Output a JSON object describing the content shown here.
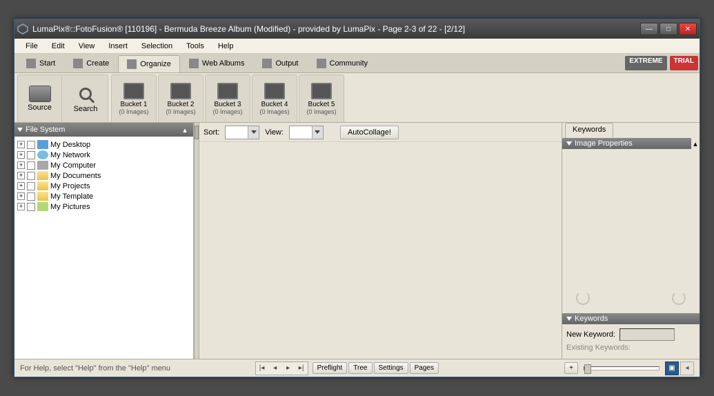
{
  "title": "LumaPix®::FotoFusion® [110196] - Bermuda Breeze Album (Modified) - provided by LumaPix - Page 2-3 of 22 - [2/12]",
  "menubar": [
    "File",
    "Edit",
    "View",
    "Insert",
    "Selection",
    "Tools",
    "Help"
  ],
  "tabs": [
    {
      "label": "Start",
      "icon": "grid-icon"
    },
    {
      "label": "Create",
      "icon": "plus-icon"
    },
    {
      "label": "Organize",
      "icon": "list-icon",
      "active": true
    },
    {
      "label": "Web Albums",
      "icon": "album-icon"
    },
    {
      "label": "Output",
      "icon": "arrow-icon"
    },
    {
      "label": "Community",
      "icon": "community-icon"
    }
  ],
  "badges": {
    "extreme": "EXTREME",
    "trial": "TRIAL"
  },
  "tools": {
    "source": "Source",
    "search": "Search"
  },
  "buckets": [
    {
      "name": "Bucket 1",
      "count": "(0 Images)"
    },
    {
      "name": "Bucket 2",
      "count": "(0 Images)"
    },
    {
      "name": "Bucket 3",
      "count": "(0 Images)"
    },
    {
      "name": "Bucket 4",
      "count": "(0 Images)"
    },
    {
      "name": "Bucket 5",
      "count": "(0 Images)"
    }
  ],
  "left_panel": {
    "title": "File System",
    "items": [
      {
        "label": "My Desktop",
        "icon": "desktop"
      },
      {
        "label": "My Network",
        "icon": "net"
      },
      {
        "label": "My Computer",
        "icon": "comp"
      },
      {
        "label": "My Documents",
        "icon": ""
      },
      {
        "label": "My Projects",
        "icon": ""
      },
      {
        "label": "My Template",
        "icon": ""
      },
      {
        "label": "My Pictures",
        "icon": "pic"
      }
    ]
  },
  "sortbar": {
    "sort": "Sort:",
    "view": "View:",
    "autocollage": "AutoCollage!"
  },
  "right_panel": {
    "tab": "Keywords",
    "sec1": "Image Properties",
    "sec2": "Keywords",
    "new_kw_label": "New Keyword:",
    "existing": "Existing Keywords:"
  },
  "status": {
    "help": "For Help, select \"Help\" from the \"Help\" menu",
    "btns": [
      "Preflight",
      "Tree",
      "Settings",
      "Pages"
    ],
    "plus": "+"
  }
}
